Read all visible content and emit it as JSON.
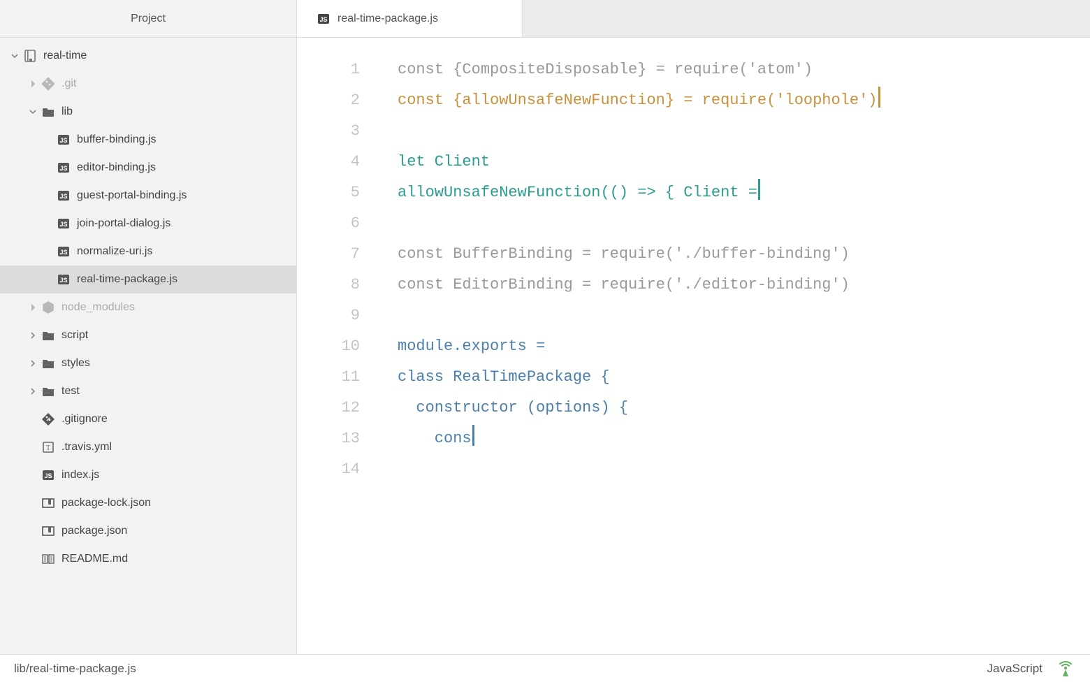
{
  "sidebar": {
    "title": "Project",
    "root": {
      "label": "real-time"
    },
    "items": [
      {
        "label": ".git"
      },
      {
        "label": "lib"
      },
      {
        "label": "buffer-binding.js"
      },
      {
        "label": "editor-binding.js"
      },
      {
        "label": "guest-portal-binding.js"
      },
      {
        "label": "join-portal-dialog.js"
      },
      {
        "label": "normalize-uri.js"
      },
      {
        "label": "real-time-package.js"
      },
      {
        "label": "node_modules"
      },
      {
        "label": "script"
      },
      {
        "label": "styles"
      },
      {
        "label": "test"
      },
      {
        "label": ".gitignore"
      },
      {
        "label": ".travis.yml"
      },
      {
        "label": "index.js"
      },
      {
        "label": "package-lock.json"
      },
      {
        "label": "package.json"
      },
      {
        "label": "README.md"
      }
    ]
  },
  "tab": {
    "title": "real-time-package.js"
  },
  "editor": {
    "line_numbers": [
      "1",
      "2",
      "3",
      "4",
      "5",
      "6",
      "7",
      "8",
      "9",
      "10",
      "11",
      "12",
      "13",
      "14"
    ],
    "lines": [
      [
        {
          "t": "const {CompositeDisposable} = require('atom')",
          "c": ""
        }
      ],
      [
        {
          "t": "const {allowUnsafeNewFunction} = require('loophole')",
          "c": "tk-orange"
        },
        {
          "cursor": "orange"
        }
      ],
      [
        {
          "t": "",
          "c": ""
        }
      ],
      [
        {
          "t": "let Client",
          "c": "tk-teal"
        }
      ],
      [
        {
          "t": "allowUnsafeNewFunction(() => { Client =",
          "c": "tk-teal"
        },
        {
          "cursor": "teal"
        }
      ],
      [
        {
          "t": "",
          "c": ""
        }
      ],
      [
        {
          "t": "const BufferBinding = require('./buffer-binding')",
          "c": ""
        }
      ],
      [
        {
          "t": "const EditorBinding = require('./editor-binding')",
          "c": ""
        }
      ],
      [
        {
          "t": "",
          "c": ""
        }
      ],
      [
        {
          "t": "module.exports =",
          "c": "tk-blue"
        }
      ],
      [
        {
          "t": "class RealTimePackage {",
          "c": "tk-blue"
        }
      ],
      [
        {
          "t": "  constructor (options) {",
          "c": "tk-blue"
        }
      ],
      [
        {
          "t": "    cons",
          "c": "tk-blue"
        },
        {
          "cursor": "blue"
        }
      ],
      [
        {
          "t": "",
          "c": ""
        }
      ]
    ]
  },
  "status": {
    "path": "lib/real-time-package.js",
    "lang": "JavaScript"
  }
}
